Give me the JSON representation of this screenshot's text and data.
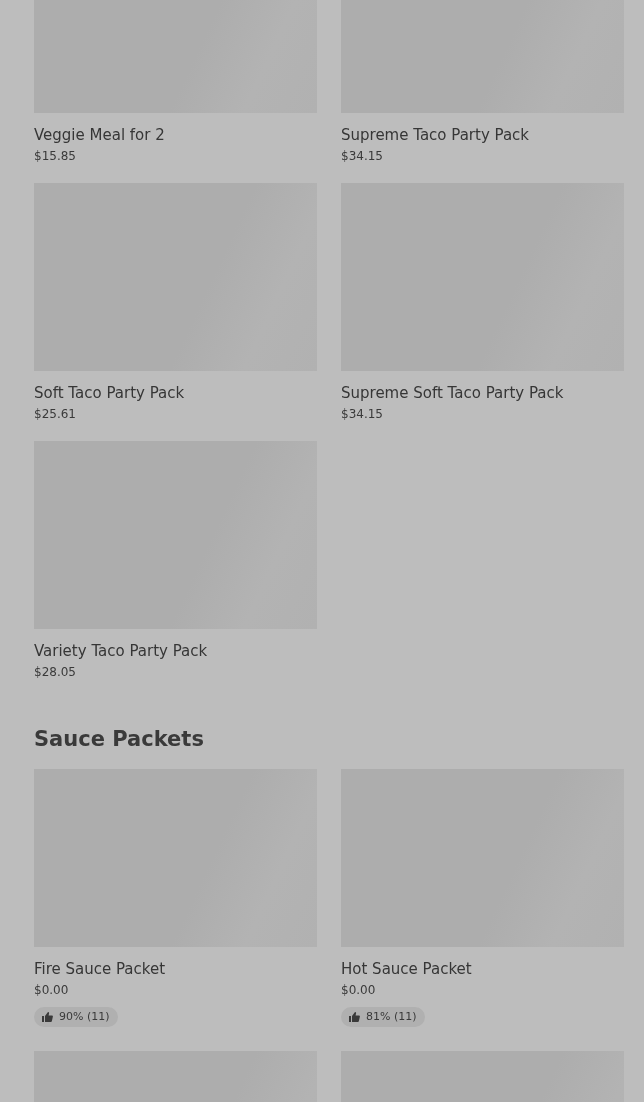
{
  "sections": [
    {
      "items": [
        {
          "kind": "product",
          "name": "Veggie Meal for 2",
          "price": "$15.85"
        },
        {
          "kind": "product",
          "name": "Supreme Taco Party Pack",
          "price": "$34.15"
        },
        {
          "kind": "product",
          "name": "Soft Taco Party Pack",
          "price": "$25.61"
        },
        {
          "kind": "product",
          "name": "Supreme Soft Taco Party Pack",
          "price": "$34.15"
        },
        {
          "kind": "product",
          "name": "Variety Taco Party Pack",
          "price": "$28.05"
        }
      ]
    },
    {
      "title": "Sauce Packets",
      "items": [
        {
          "kind": "product",
          "name": "Fire Sauce Packet",
          "price": "$0.00",
          "rating": "90% (11)"
        },
        {
          "kind": "product",
          "name": "Hot Sauce Packet",
          "price": "$0.00",
          "rating": "81% (11)"
        },
        {
          "kind": "image_only"
        },
        {
          "kind": "image_only"
        }
      ]
    }
  ]
}
